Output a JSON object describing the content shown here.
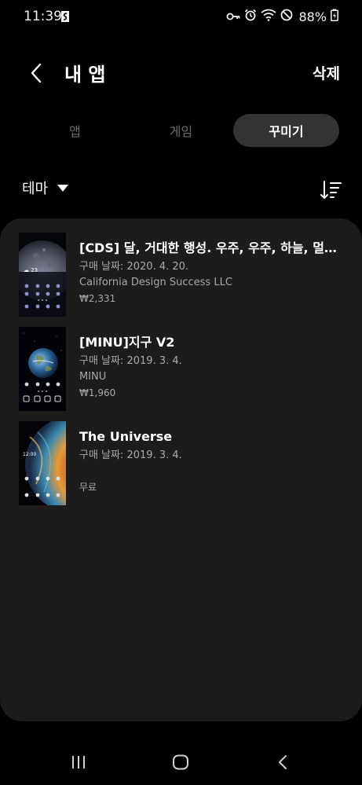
{
  "status_bar": {
    "time": "11:39",
    "battery": "88%",
    "icons": [
      "app-s-icon",
      "key-icon",
      "alarm-icon",
      "wifi-icon",
      "no-disturb-icon",
      "battery-icon"
    ]
  },
  "header": {
    "title": "내 앱",
    "delete_label": "삭제"
  },
  "tabs": [
    {
      "label": "앱",
      "selected": false
    },
    {
      "label": "게임",
      "selected": false
    },
    {
      "label": "꾸미기",
      "selected": true
    }
  ],
  "filter": {
    "category": "테마"
  },
  "items": [
    {
      "title": "[CDS] 달, 거대한 행성. 우주, 우주, 하늘, 멀리, 공간",
      "date": "구매 날짜: 2020. 4. 20.",
      "seller": "California Design Success LLC",
      "price": "₩2,331",
      "thumb": "moon"
    },
    {
      "title": "[MINU]지구 V2",
      "date": "구매 날짜: 2019. 3. 4.",
      "seller": "MINU",
      "price": "₩1,960",
      "thumb": "earth"
    },
    {
      "title": "The Universe",
      "date": "구매 날짜: 2019. 3. 4.",
      "seller": "",
      "price": "무료",
      "thumb": "planet"
    }
  ],
  "colors": {
    "background": "#000000",
    "panel": "#1c1c1c",
    "selected_tab": "#333333",
    "secondary_text": "#a8a8a8",
    "inactive_tab": "#6c6c6c"
  }
}
